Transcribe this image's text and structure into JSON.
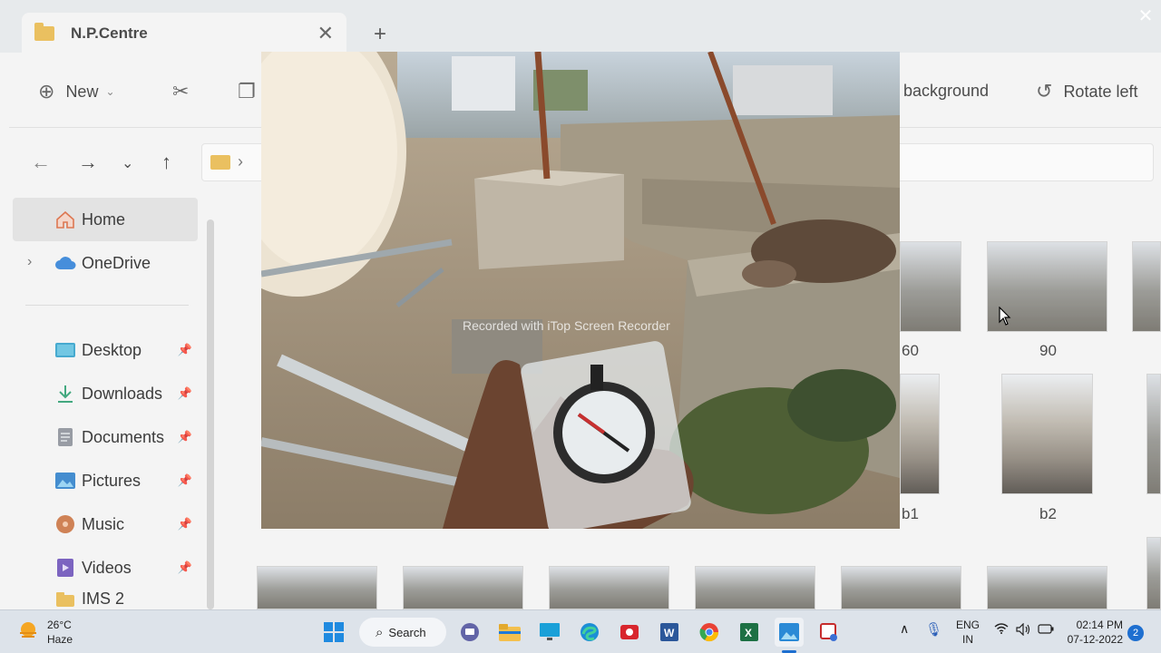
{
  "explorer": {
    "tab_title": "N.P.Centre",
    "toolbar": {
      "new_label": "New",
      "background_label": "background",
      "rotate_left_label": "Rotate left"
    },
    "sidebar": {
      "items": [
        {
          "label": "Home",
          "icon": "home-icon"
        },
        {
          "label": "OneDrive",
          "icon": "cloud-icon"
        },
        {
          "label": "Desktop",
          "icon": "desktop-icon"
        },
        {
          "label": "Downloads",
          "icon": "download-icon"
        },
        {
          "label": "Documents",
          "icon": "document-icon"
        },
        {
          "label": "Pictures",
          "icon": "pictures-icon"
        },
        {
          "label": "Music",
          "icon": "music-icon"
        },
        {
          "label": "Videos",
          "icon": "videos-icon"
        },
        {
          "label": "IMS 2",
          "icon": "folder-icon"
        }
      ]
    },
    "thumbnails": [
      {
        "label": "60"
      },
      {
        "label": "90"
      },
      {
        "label": "b1"
      },
      {
        "label": "b2"
      }
    ]
  },
  "viewer": {
    "watermark": "Recorded with iTop Screen Recorder",
    "close_icon": "close-icon"
  },
  "taskbar": {
    "weather_temp": "26°C",
    "weather_desc": "Haze",
    "search_label": "Search",
    "lang_top": "ENG",
    "lang_bottom": "IN",
    "time": "02:14 PM",
    "date": "07-12-2022",
    "notifications": "2"
  },
  "colors": {
    "accent": "#1e6fd0",
    "folder": "#e8b84a",
    "taskbar": "#dde3ea"
  }
}
